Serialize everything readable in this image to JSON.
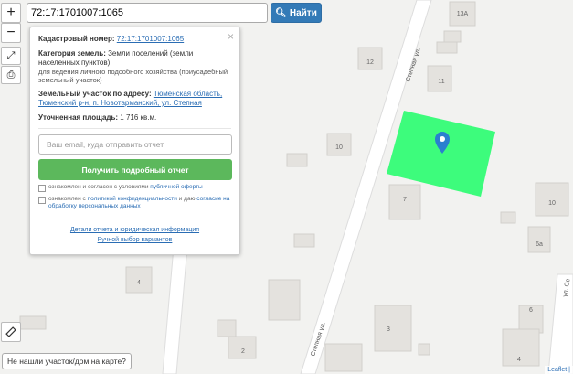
{
  "search": {
    "value": "72:17:1701007:1065",
    "button_label": "Найти"
  },
  "controls": {
    "zoom_in": "+",
    "zoom_out": "−"
  },
  "map": {
    "streets": [
      "Степная ул.",
      "Степная ул.",
      "ул. Се"
    ],
    "house_numbers": [
      "13А",
      "12",
      "11",
      "10",
      "7",
      "10",
      "6а",
      "4",
      "3",
      "2",
      "6",
      "4"
    ],
    "parcel_color": "#3dfc7c",
    "marker_color": "#2a7fcf"
  },
  "popup": {
    "close": "×",
    "cadastral_label": "Кадастровый номер:",
    "cadastral_value": "72:17:1701007:1065",
    "category_label": "Категория земель:",
    "category_value": "Земли поселений (земли населенных пунктов)",
    "category_sub": "для ведения личного подсобного хозяйства (приусадебный земельный участок)",
    "address_label": "Земельный участок по адресу:",
    "address_value": "Тюменская область, Тюменский р-н, п. Новотарманский, ул. Степная",
    "area_label": "Уточненная площадь:",
    "area_value": "1 716 кв.м.",
    "email_placeholder": "Ваш email, куда отправить отчет",
    "get_button": "Получить подробный отчет",
    "check1_prefix": "ознакомлен и согласен с условиями",
    "check1_link": "публичной оферты",
    "check2_prefix": "ознакомлен с",
    "check2_link1": "политикой конфиденциальности",
    "check2_mid": "и даю",
    "check2_link2": "согласие на обработку персональных данных",
    "footer_link1": "Детали отчета и юридическая информация",
    "footer_link2": "Ручной выбор вариантов"
  },
  "not_found": "Не нашли участок/дом на карте?",
  "attribution": "Leaflet |"
}
